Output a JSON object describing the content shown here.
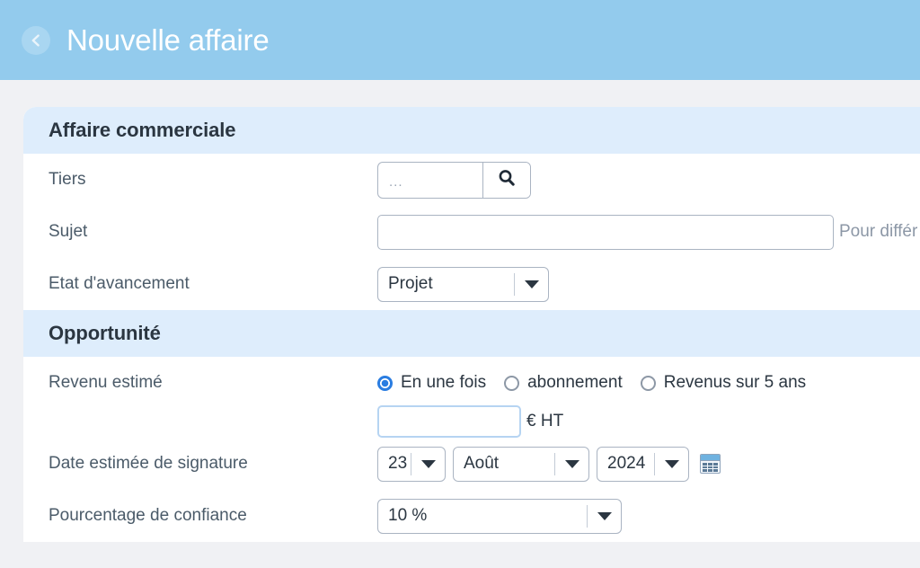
{
  "header": {
    "title": "Nouvelle affaire",
    "back_icon": "chevron-left-icon",
    "background_color": "#93cbed"
  },
  "sections": [
    {
      "title": "Affaire commerciale",
      "rows": {
        "tiers": {
          "label": "Tiers",
          "placeholder": "...",
          "value": "",
          "search_icon": "search-icon"
        },
        "sujet": {
          "label": "Sujet",
          "value": "",
          "placeholder": "",
          "helper": "Pour différ"
        },
        "etat": {
          "label": "Etat d'avancement",
          "value": "Projet",
          "options": [
            "Projet"
          ]
        }
      }
    },
    {
      "title": "Opportunité",
      "rows": {
        "revenu": {
          "label": "Revenu estimé",
          "radios": [
            {
              "label": "En une fois",
              "checked": true
            },
            {
              "label": "abonnement",
              "checked": false
            },
            {
              "label": "Revenus sur 5 ans",
              "checked": false
            }
          ],
          "amount_value": "",
          "amount_unit": "€ HT"
        },
        "date": {
          "label": "Date estimée de signature",
          "day": "23",
          "month": "Août",
          "year": "2024",
          "calendar_icon": "calendar-icon"
        },
        "pourcentage": {
          "label": "Pourcentage de confiance",
          "value": "10 %",
          "options": [
            "10 %"
          ]
        }
      }
    }
  ],
  "colors": {
    "accent": "#2a7de1",
    "header": "#93cbed",
    "section_band": "#deedfc",
    "page_bg": "#f0f1f4"
  }
}
